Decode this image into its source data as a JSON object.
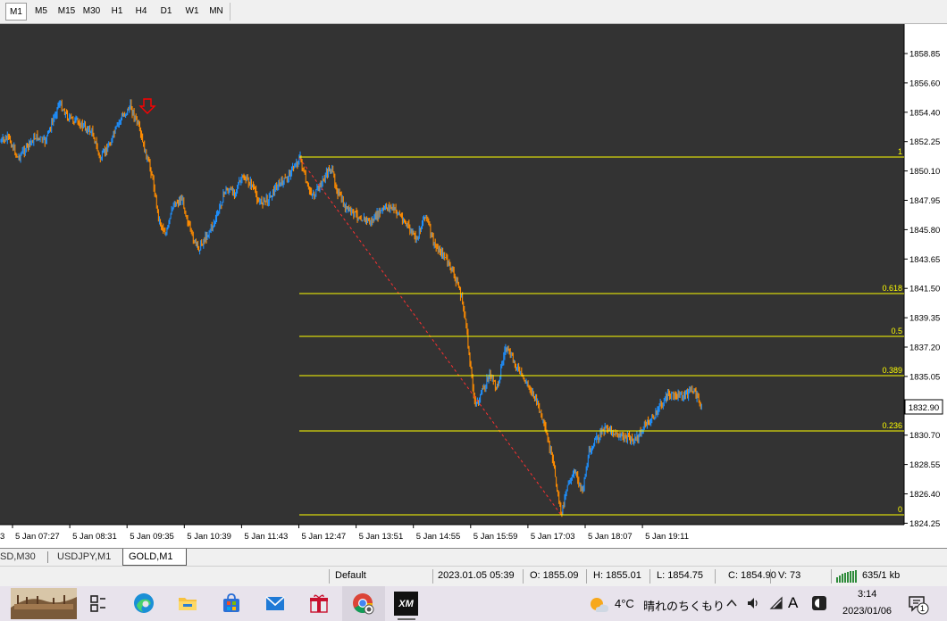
{
  "timeframes": [
    "M1",
    "M5",
    "M15",
    "M30",
    "H1",
    "H4",
    "D1",
    "W1",
    "MN"
  ],
  "active_timeframe": "M1",
  "chart": {
    "background": "#333333",
    "price_scale": [
      "1858.85",
      "1856.60",
      "1854.40",
      "1852.25",
      "1850.10",
      "1847.95",
      "1845.80",
      "1843.65",
      "1841.50",
      "1839.35",
      "1837.20",
      "1835.05",
      "1832.90",
      "1830.70",
      "1828.55",
      "1826.40",
      "1824.25"
    ],
    "current_price": "1832.90",
    "time_labels": [
      "5 Jan 07:27",
      "5 Jan 08:31",
      "5 Jan 09:35",
      "5 Jan 10:39",
      "5 Jan 11:43",
      "5 Jan 12:47",
      "5 Jan 13:51",
      "5 Jan 14:55",
      "5 Jan 15:59",
      "5 Jan 17:03",
      "5 Jan 18:07",
      "5 Jan 19:11"
    ],
    "left_edge_label": "3",
    "fibo_labels": [
      "1",
      "0.618",
      "0.5",
      "0.389",
      "0.236",
      "0"
    ],
    "fibo_color": "#ffff00",
    "bull_color": "#1e90ff",
    "bear_color": "#ff8c00",
    "arrow_color": "#ff0000"
  },
  "tabs": [
    "SD,M30",
    "USDJPY,M1",
    "GOLD,M1"
  ],
  "selected_tab": "GOLD,M1",
  "status": {
    "profile": "Default",
    "datetime": "2023.01.05 05:39",
    "open": "O: 1855.09",
    "high": "H: 1855.01",
    "low": "L: 1854.75",
    "close": "C: 1854.90",
    "volume": "V: 73",
    "traffic": "635/1 kb"
  },
  "taskbar": {
    "weather_temp": "4°C",
    "weather_text": "晴れのちくもり",
    "ime": "A",
    "time": "3:14",
    "date": "2023/01/06",
    "notification_count": "1"
  }
}
